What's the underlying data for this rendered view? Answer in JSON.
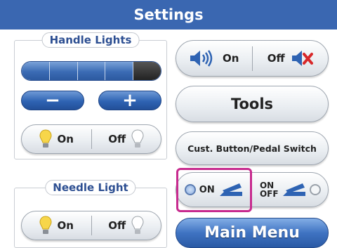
{
  "title": "Settings",
  "handle_lights": {
    "label": "Handle Lights",
    "level": {
      "filled": 4,
      "total": 5
    },
    "minus_label": "−",
    "plus_label": "+",
    "on_label": "On",
    "off_label": "Off"
  },
  "needle_light": {
    "label": "Needle Light",
    "on_label": "On",
    "off_label": "Off"
  },
  "sound": {
    "on_label": "On",
    "off_label": "Off"
  },
  "tools_label": "Tools",
  "cust_button_label": "Cust. Button/Pedal Switch",
  "pedal_switch": {
    "on_label": "ON",
    "onoff_label_line1": "ON",
    "onoff_label_line2": "OFF"
  },
  "main_menu_label": "Main Menu",
  "icons": {
    "bulb_on": "lightbulb-on-icon",
    "bulb_off": "lightbulb-off-icon",
    "speaker_on": "speaker-on-icon",
    "speaker_mute": "speaker-mute-icon",
    "pedal": "pedal-icon"
  },
  "colors": {
    "title_bar": "#3a67b1",
    "accent_blue": "#2e63b3",
    "highlight": "#c72a8e"
  }
}
